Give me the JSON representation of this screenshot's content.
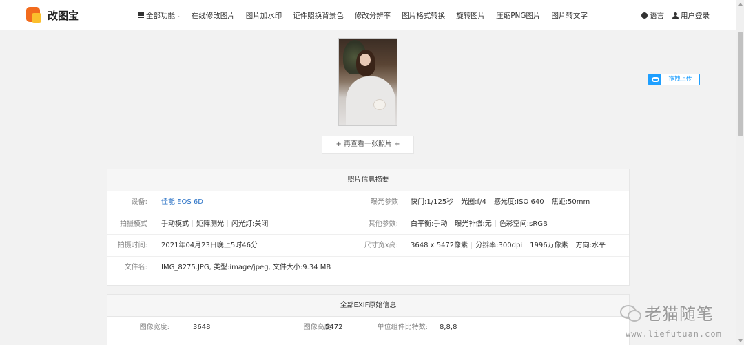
{
  "header": {
    "logo_text": "改图宝",
    "nav": [
      "全部功能",
      "在线修改图片",
      "图片加水印",
      "证件照换背景色",
      "修改分辨率",
      "图片格式转换",
      "旋转图片",
      "压缩PNG图片",
      "图片转文字"
    ],
    "right": [
      "语言",
      "用户登录"
    ]
  },
  "upload_button": "拖拽上传",
  "more_photo_button": "+ 再查看一张照片 +",
  "summary": {
    "title": "照片信息摘要",
    "rows": [
      {
        "left_label": "设备:",
        "left_value": "佳能 EOS 6D",
        "right_label": "曝光参数",
        "right_values": [
          "快门:1/125秒",
          "光圈:f/4",
          "感光度:ISO 640",
          "焦距:50mm"
        ]
      },
      {
        "left_label": "拍摄模式",
        "left_values": [
          "手动模式",
          "矩阵测光",
          "闪光灯:关闭"
        ],
        "right_label": "其他参数:",
        "right_values": [
          "白平衡:手动",
          "曝光补偿:无",
          "色彩空间:sRGB"
        ]
      },
      {
        "left_label": "拍摄时间:",
        "left_value": "2021年04月23日晚上5时46分",
        "right_label": "尺寸宽x高:",
        "right_values": [
          "3648 x 5472像素",
          "分辨率:300dpi",
          "1996万像素",
          "方向:水平"
        ]
      },
      {
        "left_label": "文件名:",
        "left_value": "IMG_8275.JPG, 类型:image/jpeg, 文件大小:9.34 MB"
      }
    ]
  },
  "exif": {
    "title": "全部EXIF原始信息",
    "row": [
      {
        "label": "图像宽度:",
        "value": "3648"
      },
      {
        "label": "图像高度:",
        "value": "5472"
      },
      {
        "label": "单位组件比特数:",
        "value": "8,8,8"
      }
    ]
  },
  "watermark": {
    "text": "老猫随笔",
    "url": "www.liefutuan.com"
  }
}
